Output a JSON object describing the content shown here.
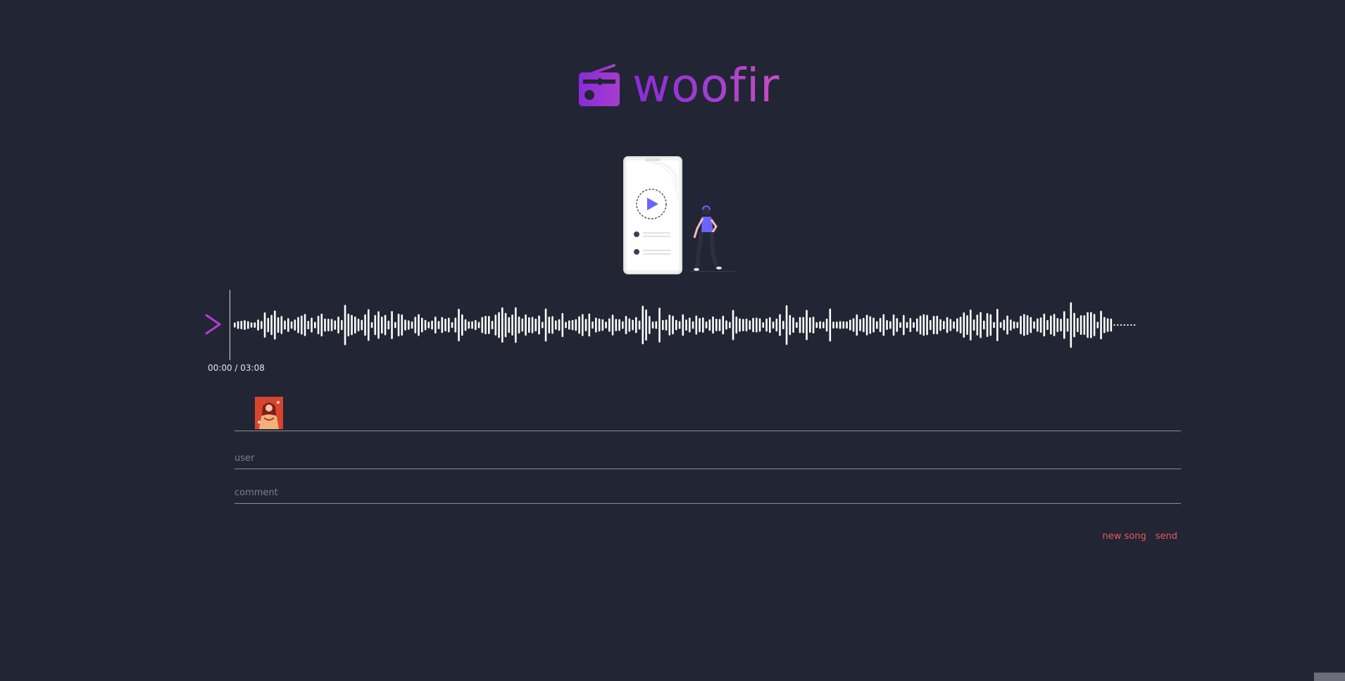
{
  "header": {
    "app_name": "woofir",
    "logo_icon": "radio-icon",
    "brand_gradient": [
      "#8a2bd9",
      "#c44fc2"
    ]
  },
  "player": {
    "play_icon": "play-chevron-icon",
    "current_time": "00:00",
    "duration": "03:08",
    "time_text": "00:00 / 03:08",
    "accent_color": "#b13fd3",
    "progress": 0
  },
  "form": {
    "cover_thumbnail": "album-cover-thumbnail",
    "user_placeholder": "user",
    "comment_placeholder": "comment",
    "new_song_label": "new song",
    "send_label": "send",
    "link_color": "#f0575d"
  },
  "theme": {
    "background": "#222533",
    "divider": "#8a8d99"
  }
}
